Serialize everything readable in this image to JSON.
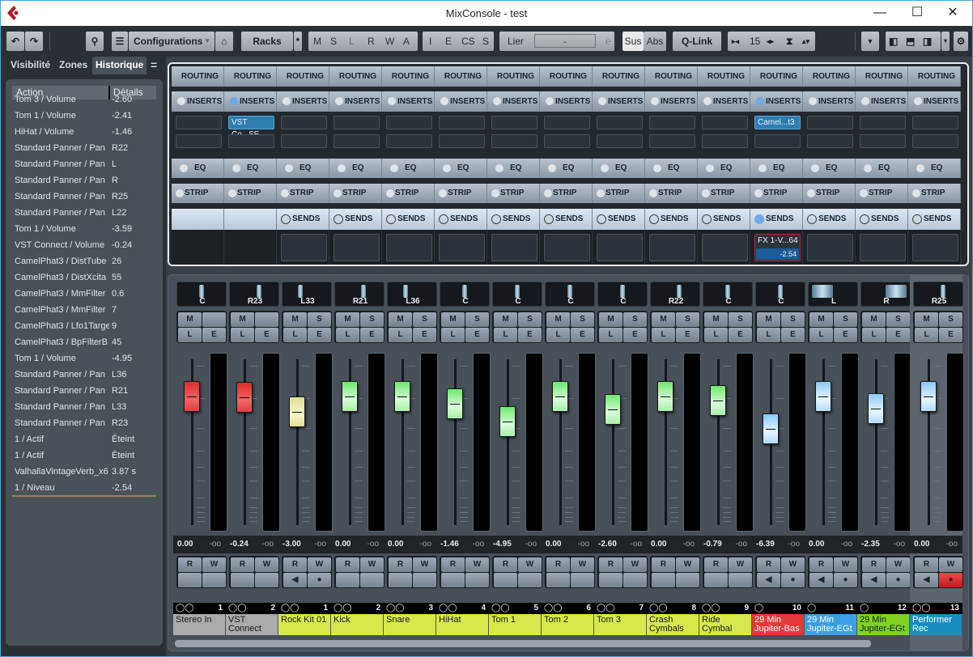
{
  "window": {
    "title": "MixConsole - test",
    "minimize": "—",
    "maximize": "☐",
    "close": "✕"
  },
  "toolbar": {
    "undo": "↶",
    "redo": "↷",
    "search": "⚲",
    "configurations": "Configurations",
    "racks": "Racks",
    "star": "*",
    "filters": [
      "M",
      "S",
      "L",
      "R",
      "W",
      "A"
    ],
    "filters2": [
      "I",
      "E",
      "CS",
      "S"
    ],
    "lier": "Lier",
    "lier_value": "-",
    "sus": "Sus",
    "abs": "Abs",
    "qlink": "Q-Link",
    "width_value": "15"
  },
  "left_panel": {
    "tabs": [
      "Visibilité",
      "Zones",
      "Historique"
    ],
    "active_tab": "Historique",
    "menu": "=",
    "headers": {
      "action": "Action",
      "details": "Détails"
    },
    "history": [
      {
        "a": "Tom 3 / Volume",
        "d": "-2.60"
      },
      {
        "a": "Tom 1 / Volume",
        "d": "-2.41"
      },
      {
        "a": "HiHat / Volume",
        "d": "-1.46"
      },
      {
        "a": "Standard Panner / Pan",
        "d": "R22"
      },
      {
        "a": "Standard Panner / Pan",
        "d": "L"
      },
      {
        "a": "Standard Panner / Pan",
        "d": "R"
      },
      {
        "a": "Standard Panner / Pan",
        "d": "R25"
      },
      {
        "a": "Standard Panner / Pan",
        "d": "L22"
      },
      {
        "a": "Tom 1 / Volume",
        "d": "-3.59"
      },
      {
        "a": "VST Connect / Volume",
        "d": "-0.24"
      },
      {
        "a": "CamelPhat3 / DistTube",
        "d": "26"
      },
      {
        "a": "CamelPhat3 / DistXcita",
        "d": "55"
      },
      {
        "a": "CamelPhat3 / MmFilter",
        "d": "0.6"
      },
      {
        "a": "CamelPhat3 / MmFilter",
        "d": "7"
      },
      {
        "a": "CamelPhat3 / Lfo1Targe",
        "d": "9"
      },
      {
        "a": "CamelPhat3 / BpFilterB",
        "d": "45"
      },
      {
        "a": "Tom 1 / Volume",
        "d": "-4.95"
      },
      {
        "a": "Standard Panner / Pan",
        "d": "L36"
      },
      {
        "a": "Standard Panner / Pan",
        "d": "R21"
      },
      {
        "a": "Standard Panner / Pan",
        "d": "L33"
      },
      {
        "a": "Standard Panner / Pan",
        "d": "R23"
      },
      {
        "a": "1 / Actif",
        "d": "Éteint"
      },
      {
        "a": "1 / Actif",
        "d": "Éteint"
      },
      {
        "a": "ValhallaVintageVerb_x6",
        "d": "3.87 s"
      },
      {
        "a": "1 / Niveau",
        "d": "-2.54"
      }
    ]
  },
  "racks": {
    "routing": "ROUTING",
    "inserts": "INSERTS",
    "eq": "EQ",
    "strip": "STRIP",
    "sends": "SENDS"
  },
  "channels": [
    {
      "num": "1",
      "name": "Stereo In",
      "color": "#a9aaab",
      "pan": "C",
      "panpos": 0.5,
      "vol": "0.00",
      "peak": "-oo",
      "fader": "red",
      "level": 0.0,
      "solo": false,
      "sends": false,
      "rec": false,
      "insert": "",
      "insert_on": false,
      "send": "",
      "send_val": "",
      "stereo": true
    },
    {
      "num": "2",
      "name": "VST Connect",
      "color": "#a9aaab",
      "pan": "R23",
      "panpos": 0.62,
      "vol": "-0.24",
      "peak": "-oo",
      "fader": "red",
      "level": -0.24,
      "solo": false,
      "sends": false,
      "rec": false,
      "insert": "VST Co...SE",
      "insert_on": true,
      "send": "",
      "send_val": "",
      "stereo": true
    },
    {
      "num": "1",
      "name": "Rock Kit 01",
      "color": "#d6e84a",
      "pan": "L33",
      "panpos": 0.33,
      "vol": "-3.00",
      "peak": "-oo",
      "fader": "yel",
      "level": -3.0,
      "solo": true,
      "sends": true,
      "rec": true,
      "insert": "",
      "insert_on": false,
      "send": "",
      "send_val": "",
      "stereo": true
    },
    {
      "num": "2",
      "name": "Kick",
      "color": "#d6e84a",
      "pan": "R21",
      "panpos": 0.6,
      "vol": "0.00",
      "peak": "-oo",
      "fader": "grn",
      "level": 0.0,
      "solo": true,
      "sends": true,
      "rec": false,
      "insert": "",
      "insert_on": false,
      "send": "",
      "send_val": "",
      "stereo": true
    },
    {
      "num": "3",
      "name": "Snare",
      "color": "#d6e84a",
      "pan": "L36",
      "panpos": 0.32,
      "vol": "0.00",
      "peak": "-oo",
      "fader": "grn",
      "level": 0.0,
      "solo": true,
      "sends": true,
      "rec": false,
      "insert": "",
      "insert_on": false,
      "send": "",
      "send_val": "",
      "stereo": true
    },
    {
      "num": "4",
      "name": "HiHat",
      "color": "#d6e84a",
      "pan": "C",
      "panpos": 0.5,
      "vol": "-1.46",
      "peak": "-oo",
      "fader": "grn",
      "level": -1.46,
      "solo": true,
      "sends": true,
      "rec": false,
      "insert": "",
      "insert_on": false,
      "send": "",
      "send_val": "",
      "stereo": true
    },
    {
      "num": "5",
      "name": "Tom 1",
      "color": "#d6e84a",
      "pan": "C",
      "panpos": 0.5,
      "vol": "-4.95",
      "peak": "-oo",
      "fader": "grn",
      "level": -4.95,
      "solo": true,
      "sends": true,
      "rec": false,
      "insert": "",
      "insert_on": false,
      "send": "",
      "send_val": "",
      "stereo": true
    },
    {
      "num": "6",
      "name": "Tom 2",
      "color": "#d6e84a",
      "pan": "C",
      "panpos": 0.5,
      "vol": "0.00",
      "peak": "-oo",
      "fader": "grn",
      "level": 0.0,
      "solo": true,
      "sends": true,
      "rec": false,
      "insert": "",
      "insert_on": false,
      "send": "",
      "send_val": "",
      "stereo": true
    },
    {
      "num": "7",
      "name": "Tom 3",
      "color": "#d6e84a",
      "pan": "C",
      "panpos": 0.5,
      "vol": "-2.60",
      "peak": "-oo",
      "fader": "grn",
      "level": -2.6,
      "solo": true,
      "sends": true,
      "rec": false,
      "insert": "",
      "insert_on": false,
      "send": "",
      "send_val": "",
      "stereo": true
    },
    {
      "num": "8",
      "name": "Crash Cymbals",
      "color": "#d6e84a",
      "pan": "R22",
      "panpos": 0.61,
      "vol": "0.00",
      "peak": "-oo",
      "fader": "grn",
      "level": 0.0,
      "solo": true,
      "sends": true,
      "rec": false,
      "insert": "",
      "insert_on": false,
      "send": "",
      "send_val": "",
      "stereo": true
    },
    {
      "num": "9",
      "name": "Ride Cymbal",
      "color": "#d6e84a",
      "pan": "C",
      "panpos": 0.5,
      "vol": "-0.79",
      "peak": "-oo",
      "fader": "grn",
      "level": -0.79,
      "solo": true,
      "sends": true,
      "rec": false,
      "insert": "",
      "insert_on": false,
      "send": "",
      "send_val": "",
      "stereo": true
    },
    {
      "num": "10",
      "name": "29 Min Jupiter-Bas",
      "color": "#e23a3a",
      "pan": "C",
      "panpos": 0.5,
      "vol": "-6.39",
      "peak": "-oo",
      "fader": "blu",
      "level": -6.39,
      "solo": true,
      "sends": true,
      "rec": true,
      "insert": "Camel...t3",
      "insert_on": true,
      "send": "FX 1-V...64",
      "send_val": "-2.54",
      "stereo": false
    },
    {
      "num": "11",
      "name": "29 Min Jupiter-EGt",
      "color": "#3aa0e6",
      "pan": "L",
      "panpos": 0.0,
      "vol": "0.00",
      "peak": "-oo",
      "fader": "blu",
      "level": 0.0,
      "solo": true,
      "sends": true,
      "rec": true,
      "insert": "",
      "insert_on": false,
      "send": "",
      "send_val": "",
      "stereo": false
    },
    {
      "num": "12",
      "name": "29 Min Jupiter-EGt",
      "color": "#7ed321",
      "pan": "R",
      "panpos": 1.0,
      "vol": "-2.35",
      "peak": "-oo",
      "fader": "blu",
      "level": -2.35,
      "solo": true,
      "sends": true,
      "rec": true,
      "insert": "",
      "insert_on": false,
      "send": "",
      "send_val": "",
      "stereo": false
    },
    {
      "num": "13",
      "name": "Performer Rec",
      "color": "#1a8ec0",
      "pan": "R25",
      "panpos": 0.63,
      "vol": "0.00",
      "peak": "-oo",
      "fader": "blu",
      "level": 0.0,
      "solo": true,
      "sends": true,
      "rec": true,
      "rec_armed": true,
      "insert": "",
      "insert_on": false,
      "send": "",
      "send_val": "",
      "stereo": true
    }
  ],
  "labels": {
    "m": "M",
    "s": "S",
    "l": "L",
    "e": "E",
    "r": "R",
    "w": "W",
    "speaker": "◀",
    "record": "●"
  }
}
